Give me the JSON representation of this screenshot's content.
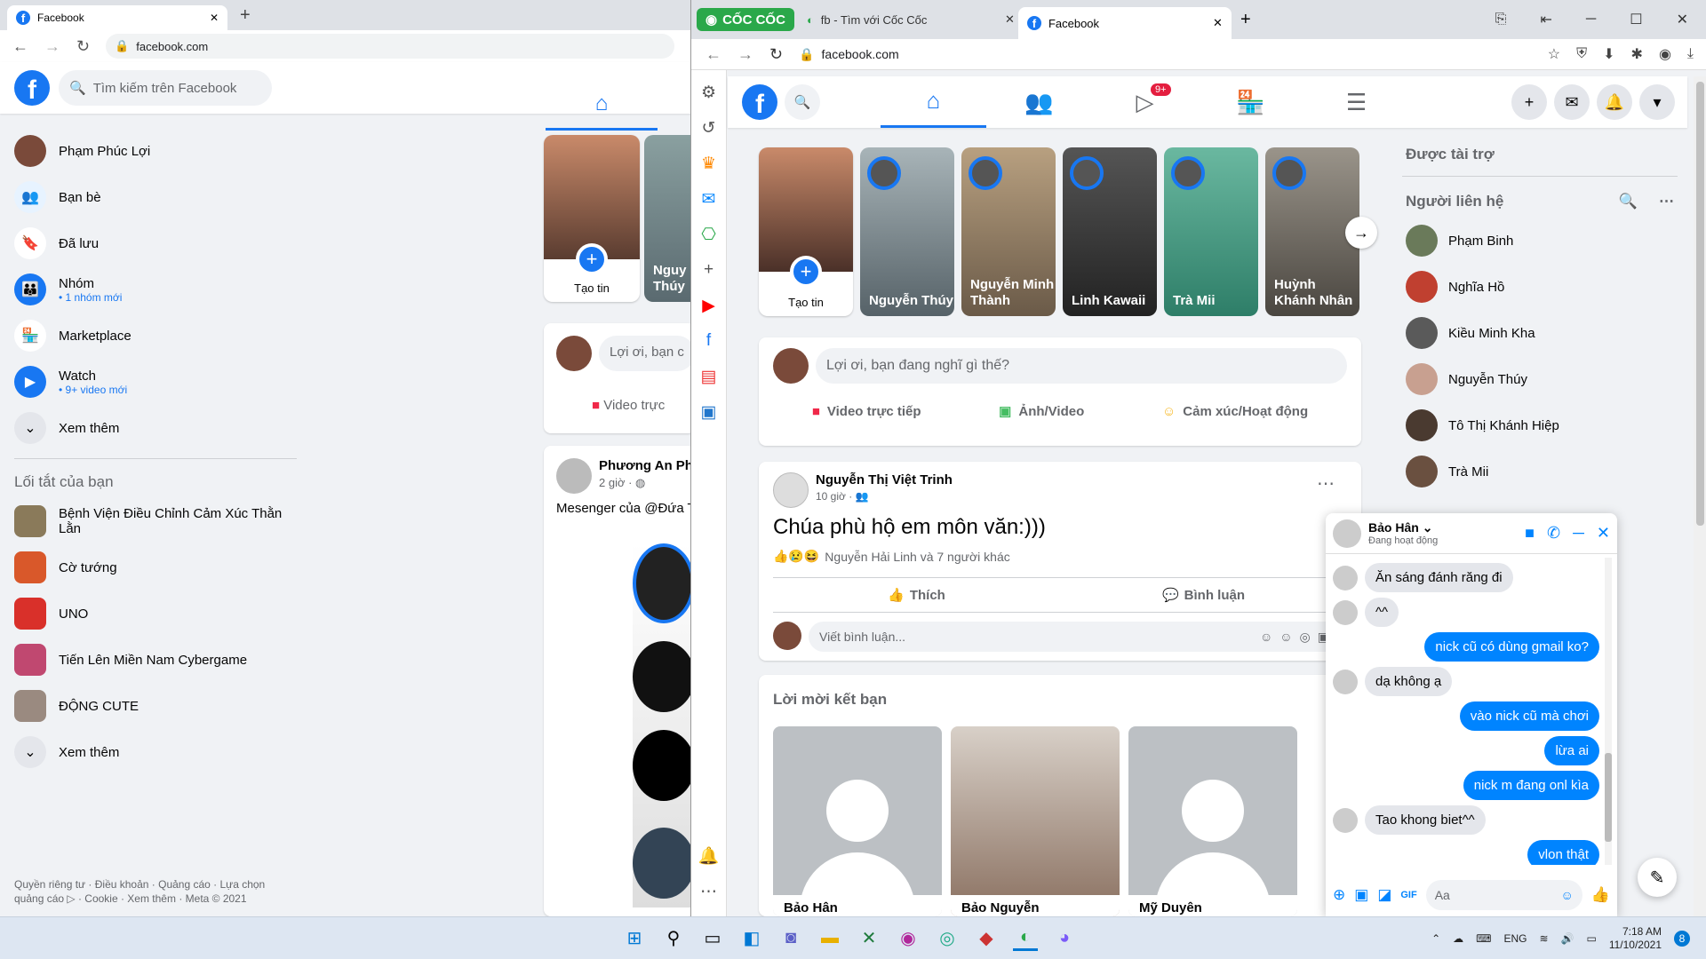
{
  "back": {
    "tab_title": "Facebook",
    "url": "facebook.com",
    "search_placeholder": "Tìm kiếm trên Facebook",
    "sidebar": [
      {
        "label": "Phạm Phúc Lợi",
        "sub": ""
      },
      {
        "label": "Bạn bè",
        "sub": ""
      },
      {
        "label": "Đã lưu",
        "sub": ""
      },
      {
        "label": "Nhóm",
        "sub": "• 1 nhóm mới"
      },
      {
        "label": "Marketplace",
        "sub": ""
      },
      {
        "label": "Watch",
        "sub": "• 9+ video mới"
      },
      {
        "label": "Xem thêm",
        "sub": ""
      }
    ],
    "shortcuts_title": "Lối tắt của bạn",
    "shortcuts": [
      "Bệnh Viện Điều Chỉnh Cảm Xúc Thằn Lằn",
      "Cờ tướng",
      "UNO",
      "Tiến Lên Miền Nam Cybergame",
      "ĐỘNG CUTE",
      "Xem thêm"
    ],
    "footer": "Quyền riêng tư · Điều khoản · Quảng cáo · Lựa chọn quảng cáo ▷ · Cookie · Xem thêm · Meta © 2021",
    "story_create": "Tạo tin",
    "story2": "Nguy Thúy",
    "composer": "Lợi ơi, bạn c",
    "live": "Video trực",
    "post_author": "Phương An Ph",
    "post_time": "2 giờ · ",
    "post_text": "Mesenger của @Đứa T"
  },
  "front": {
    "brand": "CỐC CỐC",
    "tabs": [
      "fb - Tìm với Cốc Cốc",
      "Facebook"
    ],
    "url": "facebook.com",
    "badge": "9+",
    "stories": [
      {
        "name": "Tạo tin"
      },
      {
        "name": "Nguyễn Thúy"
      },
      {
        "name": "Nguyễn Minh Thành"
      },
      {
        "name": "Linh Kawaii"
      },
      {
        "name": "Trà Mii"
      },
      {
        "name": "Huỳnh Khánh Nhân"
      }
    ],
    "composer_placeholder": "Lợi ơi, bạn đang nghĩ gì thế?",
    "composer_actions": [
      "Video trực tiếp",
      "Ảnh/Video",
      "Cảm xúc/Hoạt động"
    ],
    "post": {
      "author": "Nguyễn Thị Việt Trinh",
      "time": "10 giờ · ",
      "text": "Chúa phù hộ em môn văn:)))",
      "reactions": "Nguyễn Hải Linh và 7 người khác",
      "like": "Thích",
      "comment": "Bình luận",
      "comment_placeholder": "Viết bình luận..."
    },
    "friend_requests": {
      "title": "Lời mời kết bạn",
      "names": [
        "Bảo Hân",
        "Bảo Nguyễn",
        "Mỹ Duyên"
      ]
    },
    "sponsored": "Được tài trợ",
    "contacts_title": "Người liên hệ",
    "contacts": [
      "Phạm Binh",
      "Nghĩa Hồ",
      "Kiều Minh Kha",
      "Nguyễn Thúy",
      "Tô Thị Khánh Hiệp",
      "Trà Mii"
    ],
    "chat": {
      "name": "Bảo Hân",
      "status": "Đang hoạt động",
      "messages": [
        {
          "from": "them",
          "text": "Ăn sáng đánh răng đi"
        },
        {
          "from": "them",
          "text": "^^"
        },
        {
          "from": "me",
          "text": "nick cũ có dùng gmail ko?"
        },
        {
          "from": "them",
          "text": "dạ không ạ"
        },
        {
          "from": "me",
          "text": "vào nick cũ mà chơi"
        },
        {
          "from": "me",
          "text": "lừa ai"
        },
        {
          "from": "me",
          "text": "nick m đang onl kìa"
        },
        {
          "from": "them",
          "text": "Tao khong biet^^"
        },
        {
          "from": "me",
          "text": "vlon thật"
        }
      ],
      "input_placeholder": "Aa"
    }
  },
  "taskbar": {
    "lang": "ENG",
    "time": "7:18 AM",
    "date": "11/10/2021",
    "notif": "8"
  }
}
